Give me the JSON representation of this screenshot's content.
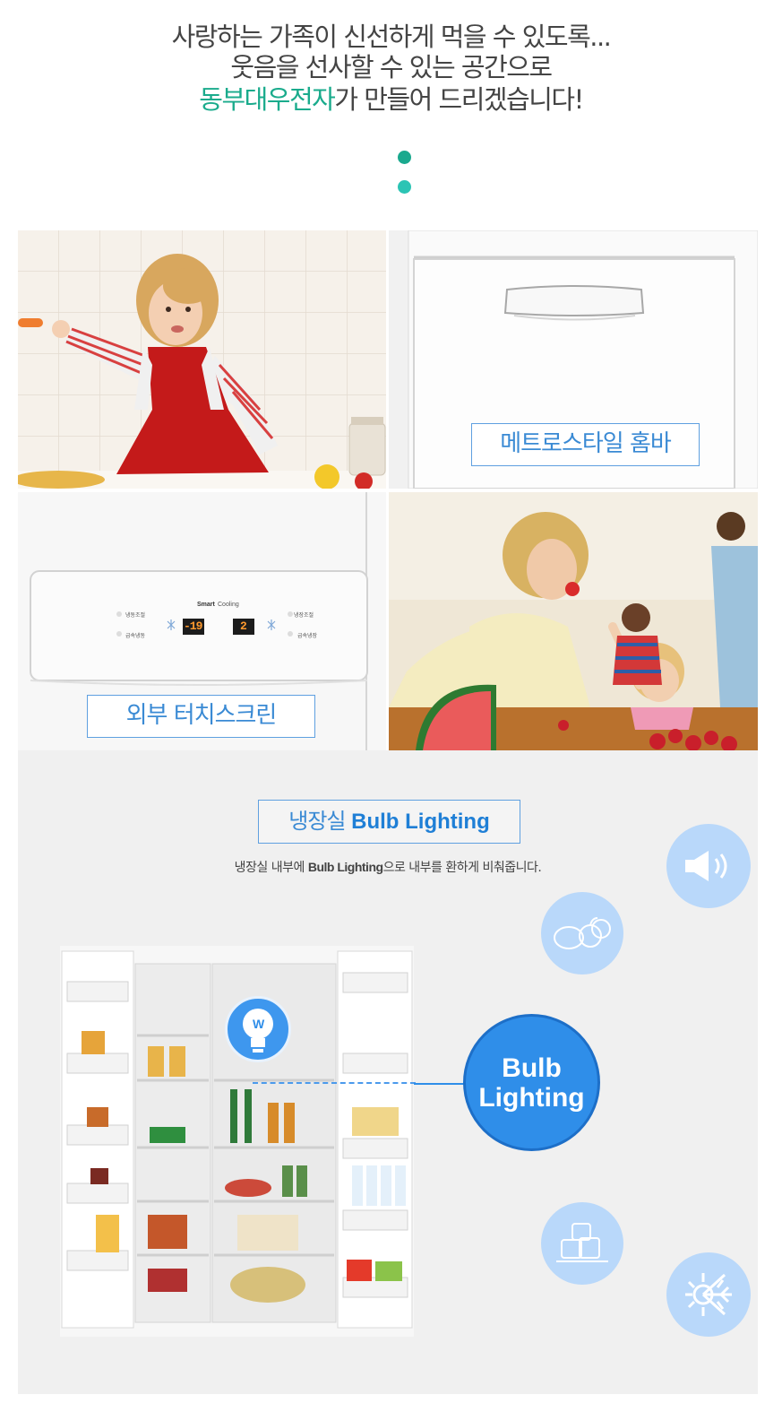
{
  "headline": {
    "line1": "사랑하는 가족이 신선하게 먹을 수 있도록...",
    "line2": "웃음을 선사할 수 있는 공간으로",
    "brand": "동부대우전자",
    "line3_rest": "가 만들어 드리겠습니다!"
  },
  "tiles": {
    "hombar_label": "메트로스타일 홈바",
    "touch_label": "외부 터치스크린",
    "panel": {
      "smart": "Smart",
      "cooling": "Cooling",
      "left_top": "냉동조절",
      "left_bottom": "급속냉동",
      "right_top": "냉장조절",
      "right_bottom": "급속냉장",
      "freezer_temp": "-19",
      "fridge_temp": "2"
    }
  },
  "bulb_section": {
    "title_korean": "냉장실",
    "title_english": "Bulb Lighting",
    "desc_pre": "냉장실 내부에 ",
    "desc_bold": "Bulb Lighting",
    "desc_post": "으로 내부를 환하게 비춰줍니다.",
    "circle_line1": "Bulb",
    "circle_line2": "Lighting",
    "bulb_letter": "W"
  },
  "icons": [
    "speaker-icon",
    "vegetables-icon",
    "ice-cubes-icon",
    "snowflake-icon",
    "bulb-icon"
  ],
  "colors": {
    "brand_green": "#1aab8c",
    "accent_blue": "#2f8ee9",
    "light_blue": "#b9d8fa",
    "label_blue": "#3a8ad4"
  }
}
